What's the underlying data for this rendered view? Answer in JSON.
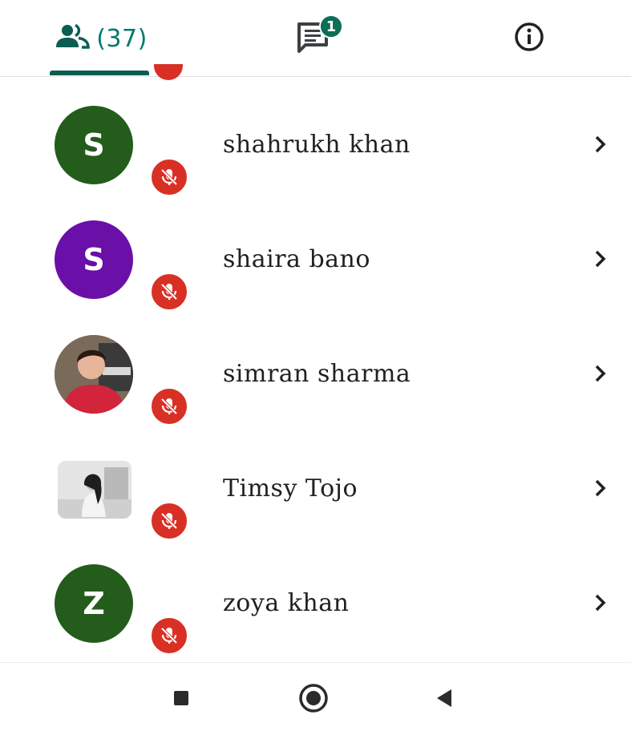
{
  "tabs": {
    "people": {
      "icon": "people-icon",
      "count_label": "(37)"
    },
    "chat": {
      "icon": "chat-icon",
      "badge": "1"
    },
    "info": {
      "icon": "info-icon"
    }
  },
  "participants": [
    {
      "name": "shahrukh khan",
      "initial": "S",
      "avatar_color": "#235c1b",
      "avatar_type": "initial",
      "muted": true
    },
    {
      "name": "shaira bano",
      "initial": "S",
      "avatar_color": "#6a0fa8",
      "avatar_type": "initial",
      "muted": true
    },
    {
      "name": "simran sharma",
      "initial": "",
      "avatar_color": "#c62e3d",
      "avatar_type": "photo",
      "muted": true
    },
    {
      "name": "Timsy Tojo",
      "initial": "",
      "avatar_color": "#dcdcdc",
      "avatar_type": "photo",
      "muted": true
    },
    {
      "name": "zoya khan",
      "initial": "Z",
      "avatar_color": "#235c1b",
      "avatar_type": "initial",
      "muted": true
    }
  ],
  "colors": {
    "accent": "#0b5d52",
    "mute_red": "#d93025",
    "count_teal": "#00796b"
  },
  "system_nav": {
    "recents": "square-icon",
    "home": "home-circle-icon",
    "back": "back-triangle-icon"
  }
}
